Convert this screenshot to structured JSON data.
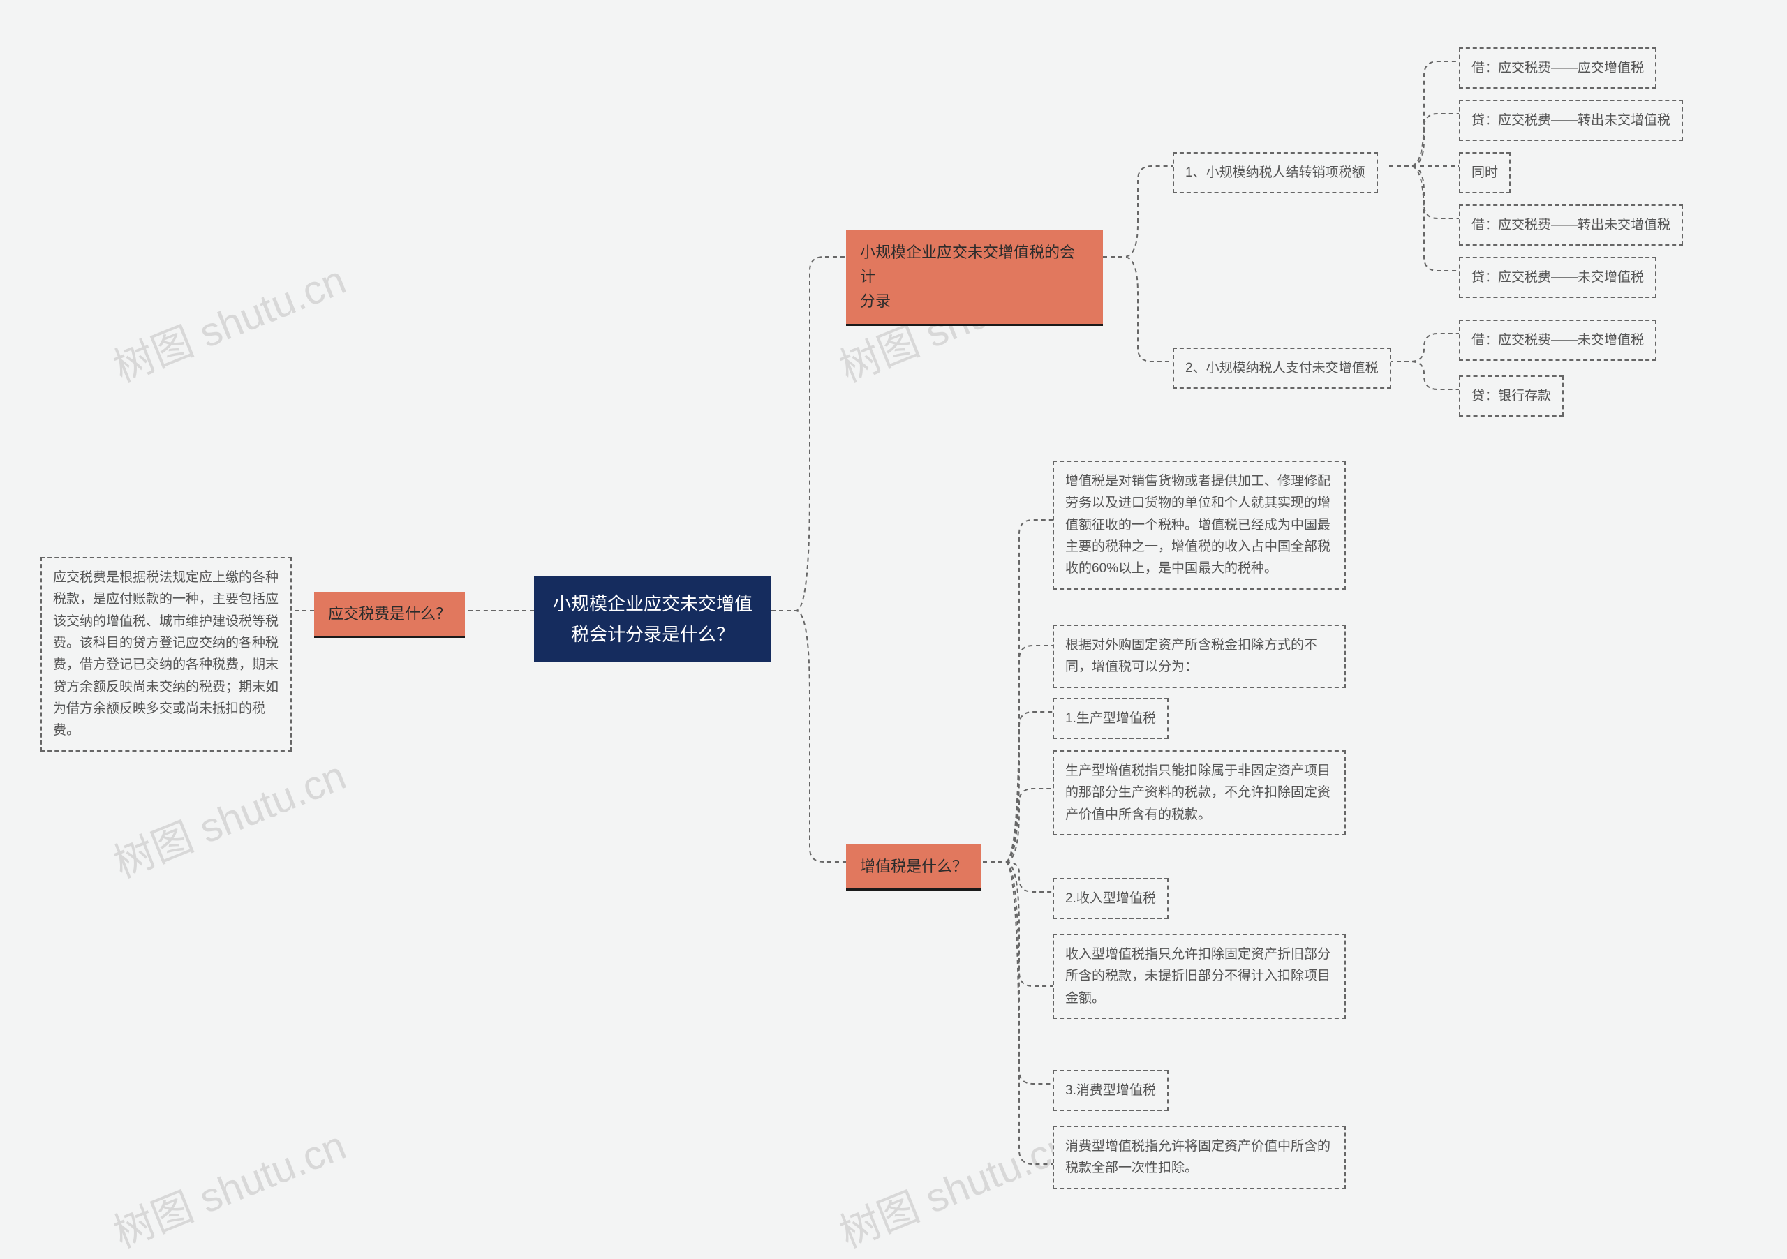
{
  "watermark": "树图 shutu.cn",
  "root": "小规模企业应交未交增值\n税会计分录是什么？",
  "left": {
    "branch": "应交税费是什么？",
    "detail": "应交税费是根据税法规定应上缴的各种税款，是应付账款的一种，主要包括应该交纳的增值税、城市维护建设税等税费。该科目的贷方登记应交纳的各种税费，借方登记已交纳的各种税费，期末贷方余额反映尚未交纳的税费；期末如为借方余额反映多交或尚未抵扣的税费。"
  },
  "right1": {
    "branch": "小规模企业应交未交增值税的会计\n分录",
    "sub1": {
      "label": "1、小规模纳税人结转销项税额",
      "items": [
        "借：应交税费——应交增值税",
        "贷：应交税费——转出未交增值税",
        "同时",
        "借：应交税费——转出未交增值税",
        "贷：应交税费——未交增值税"
      ]
    },
    "sub2": {
      "label": "2、小规模纳税人支付未交增值税",
      "items": [
        "借：应交税费——未交增值税",
        "贷：银行存款"
      ]
    }
  },
  "right2": {
    "branch": "增值税是什么？",
    "items": [
      "增值税是对销售货物或者提供加工、修理修配劳务以及进口货物的单位和个人就其实现的增值额征收的一个税种。增值税已经成为中国最主要的税种之一，增值税的收入占中国全部税收的60%以上，是中国最大的税种。",
      "根据对外购固定资产所含税金扣除方式的不同，增值税可以分为：",
      "1.生产型增值税",
      "生产型增值税指只能扣除属于非固定资产项目的那部分生产资料的税款，不允许扣除固定资产价值中所含有的税款。",
      "2.收入型增值税",
      "收入型增值税指只允许扣除固定资产折旧部分所含的税款，未提折旧部分不得计入扣除项目金额。",
      "3.消费型增值税",
      "消费型增值税指允许将固定资产价值中所含的税款全部一次性扣除。"
    ]
  }
}
